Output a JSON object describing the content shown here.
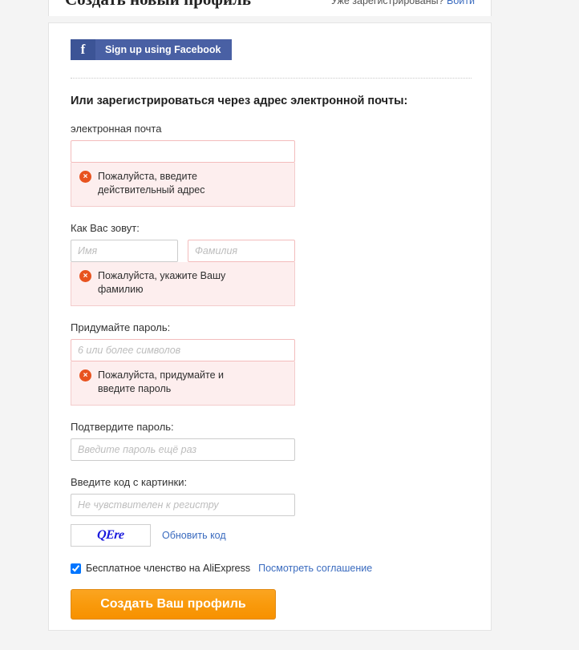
{
  "header": {
    "title": "Создать новый профиль",
    "login_hint": "Уже зарегистрированы?",
    "login_link": "Войти"
  },
  "social": {
    "facebook_icon": "facebook-f-icon",
    "facebook_label": "Sign up using Facebook",
    "facebook_color": "#4960a4"
  },
  "form": {
    "section_heading": "Или зарегистрироваться через адрес электронной почты:",
    "email": {
      "label": "электронная почта",
      "value": "",
      "placeholder": "",
      "error": "Пожалуйста, введите действительный адрес"
    },
    "name": {
      "label": "Как Вас зовут:",
      "first_placeholder": "Имя",
      "first_value": "",
      "last_placeholder": "Фамилия",
      "last_value": "",
      "error": "Пожалуйста, укажите Вашу фамилию"
    },
    "password": {
      "label": "Придумайте пароль:",
      "placeholder": "6 или более символов",
      "value": "",
      "error": "Пожалуйста, придумайте и введите пароль"
    },
    "confirm": {
      "label": "Подтвердите пароль:",
      "placeholder": "Введите пароль ещё раз",
      "value": ""
    },
    "captcha": {
      "label": "Введите код с картинки:",
      "placeholder": "Не чувствителен к регистру",
      "value": "",
      "image_text": "QEre",
      "refresh_label": "Обновить код"
    },
    "agreement": {
      "checked": true,
      "text": "Бесплатное членство на AliExpress",
      "link": "Посмотреть соглашение"
    },
    "submit_label": "Создать Ваш профиль"
  },
  "colors": {
    "error_icon": "#e8531f",
    "error_bg": "#fdeeee",
    "link": "#3a6bbf",
    "accent": "#f99a0c"
  },
  "icons": {
    "error": "×"
  }
}
